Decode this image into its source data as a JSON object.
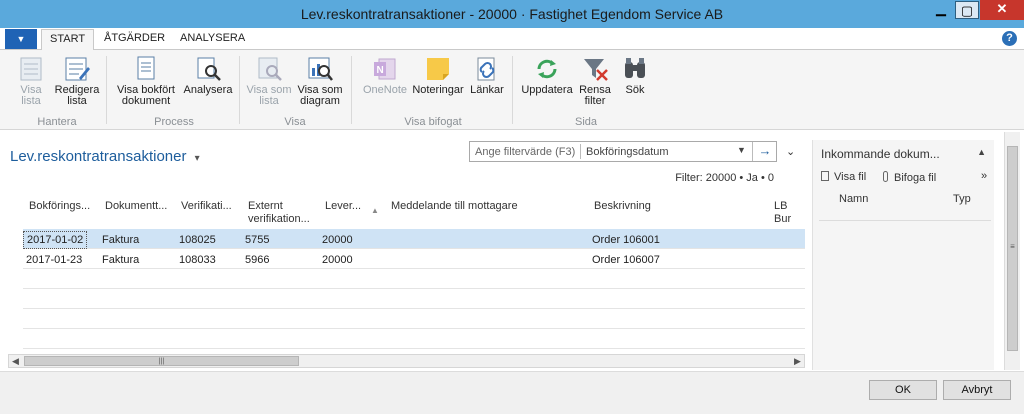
{
  "window": {
    "title": "Lev.reskontratransaktioner - 20000 · Fastighet Egendom Service AB",
    "min": "▁",
    "max": "▢",
    "close": "✕"
  },
  "ribbon_tabs": {
    "app_menu": "▼",
    "tabs": [
      "START",
      "ÅTGÄRDER",
      "ANALYSERA"
    ],
    "help": "?"
  },
  "ribbon": {
    "visa_lista": "Visa lista",
    "redigera_lista": "Redigera lista",
    "hantera": "Hantera",
    "visa_bokfort": "Visa bokfört dokument",
    "analysera": "Analysera",
    "process": "Process",
    "visa_som_lista": "Visa som lista",
    "visa_som_diagram": "Visa som diagram",
    "visa": "Visa",
    "onenote": "OneNote",
    "noteringar": "Noteringar",
    "lankar": "Länkar",
    "visa_bifogat": "Visa bifogat",
    "uppdatera": "Uppdatera",
    "rensa_filter": "Rensa filter",
    "sok": "Sök",
    "sida": "Sida"
  },
  "main": {
    "title": "Lev.reskontratransaktioner",
    "title_dropdown": "▾",
    "filter_placeholder": "Ange filtervärde (F3)",
    "filter_field": "Bokföringsdatum",
    "filter_dd": "▼",
    "filter_go": "→",
    "expand": "⌄",
    "filter_info": "Filter: 20000 • Ja • 0"
  },
  "table": {
    "headers": [
      "Bokförings...",
      "Dokumentt...",
      "Verifikati...",
      "Externt\nverifikation...",
      "Lever...",
      "Meddelande till mottagare",
      "Beskrivning",
      "LB Bur"
    ],
    "rows": [
      [
        "2017-01-02",
        "Faktura",
        "108025",
        "5755",
        "20000",
        "",
        "Order 106001"
      ],
      [
        "2017-01-23",
        "Faktura",
        "108033",
        "5966",
        "20000",
        "",
        "Order 106007"
      ]
    ]
  },
  "side_pane": {
    "title": "Inkommande dokum...",
    "collapse": "▲",
    "visa_fil": "Visa fil",
    "bifoga_fil": "Bifoga fil",
    "more": "»",
    "col_namn": "Namn",
    "col_typ": "Typ"
  },
  "footer": {
    "ok": "OK",
    "avbryt": "Avbryt"
  },
  "colors": {
    "titlebar": "#5aa9dc",
    "accent": "#1d5d9c",
    "selection": "#cfe3f5",
    "close": "#c7362c"
  }
}
